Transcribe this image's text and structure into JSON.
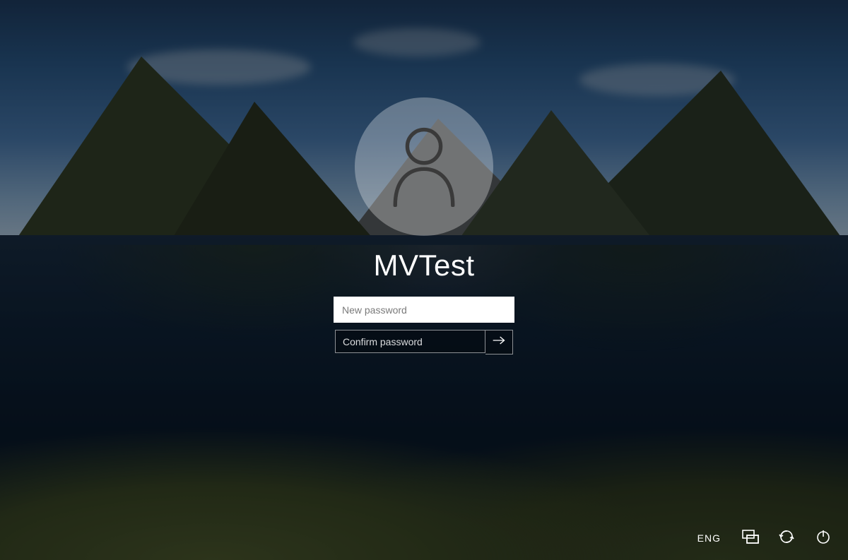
{
  "login": {
    "username": "MVTest",
    "new_password_placeholder": "New password",
    "confirm_password_placeholder": "Confirm password"
  },
  "tray": {
    "language": "ENG"
  }
}
